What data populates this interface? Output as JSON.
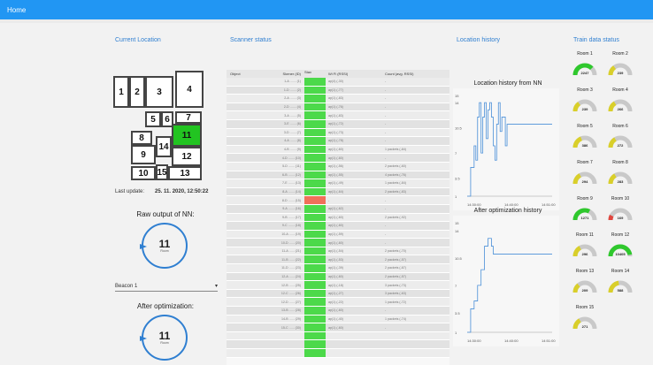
{
  "nav": {
    "home_label": "Home"
  },
  "sections": {
    "current_location": "Current Location",
    "scanner_status": "Scanner status",
    "location_history": "Location history",
    "train_data_status": "Train data status"
  },
  "rooms": [
    {
      "label": "1",
      "active": false
    },
    {
      "label": "2",
      "active": false
    },
    {
      "label": "3",
      "active": false
    },
    {
      "label": "4",
      "active": false
    },
    {
      "label": "5",
      "active": false
    },
    {
      "label": "6",
      "active": false
    },
    {
      "label": "7",
      "active": false
    },
    {
      "label": "8",
      "active": false
    },
    {
      "label": "9",
      "active": false
    },
    {
      "label": "10",
      "active": false
    },
    {
      "label": "11",
      "active": true
    },
    {
      "label": "12",
      "active": false
    },
    {
      "label": "13",
      "active": false
    },
    {
      "label": "14",
      "active": false
    },
    {
      "label": "15",
      "active": false
    }
  ],
  "last_update": {
    "label": "Last update:",
    "value": "25. 11. 2020, 12:50:22"
  },
  "nn_output": {
    "label": "Raw output of NN:",
    "value": "11",
    "unit": "Room"
  },
  "beacon_select": {
    "value": "Beacon 1"
  },
  "after_opt": {
    "label": "After optimization:",
    "value": "11",
    "unit": "Room"
  },
  "scanner_table": {
    "columns": [
      "Object",
      "Skener (ID)",
      "Stav",
      "Wi Fi (RSSI)",
      "Count (avg. RSSI)"
    ],
    "rows": [
      [
        "1-A ....... (1)",
        "green",
        "ap(4) (-30)",
        "-"
      ],
      [
        "1-D ....... (2)",
        "green",
        "ap(1) (-77)",
        "-"
      ],
      [
        "2-A ....... (3)",
        "green",
        "ap(1) (-83)",
        "-"
      ],
      [
        "2-D ....... (4)",
        "green",
        "ap(1) (-76)",
        "-"
      ],
      [
        "3-A ....... (5)",
        "green",
        "ap(1) (-83)",
        "-"
      ],
      [
        "3-E ....... (6)",
        "green",
        "ap(1) (-72)",
        "-"
      ],
      [
        "3-D ....... (7)",
        "green",
        "ap(1) (-73)",
        "-"
      ],
      [
        "4-A ....... (8)",
        "green",
        "ap(1) (-78)",
        "-"
      ],
      [
        "4-B ....... (9)",
        "green",
        "ap(1) (-60)",
        "1 packets (-84)"
      ],
      [
        "4-D ....... (10)",
        "green",
        "ap(1) (-60)",
        "-"
      ],
      [
        "5-D ....... (11)",
        "green",
        "ap(1) (-56)",
        "2 packets (-60)"
      ],
      [
        "6-B ....... (12)",
        "green",
        "ap(1) (-55)",
        "4 packets (-76)"
      ],
      [
        "7-E ....... (13)",
        "green",
        "ap(1) (-49)",
        "1 packets (-84)"
      ],
      [
        "8-A ....... (14)",
        "green",
        "ap(1) (-64)",
        "2 packets (-83)"
      ],
      [
        "8-D ....... (15)",
        "red",
        "-",
        "-"
      ],
      [
        "9-A ....... (16)",
        "green",
        "ap(1) (-62)",
        "-"
      ],
      [
        "9-B ....... (17)",
        "green",
        "ap(1) (-60)",
        "2 packets (-92)"
      ],
      [
        "9-C ....... (18)",
        "green",
        "ap(1) (-60)",
        "-"
      ],
      [
        "10-A ...... (19)",
        "green",
        "ap(1) (-59)",
        "-"
      ],
      [
        "10-D ...... (20)",
        "green",
        "ap(1) (-60)",
        "-"
      ],
      [
        "11-A ...... (21)",
        "green",
        "ap(1) (-54)",
        "2 packets (-70)"
      ],
      [
        "11-B ...... (22)",
        "green",
        "ap(1) (-53)",
        "2 packets (-57)"
      ],
      [
        "11-D ...... (23)",
        "green",
        "ap(1) (-39)",
        "2 packets (-67)"
      ],
      [
        "12-A ...... (24)",
        "green",
        "ap(1) (-60)",
        "2 packets (-57)"
      ],
      [
        "12-B ...... (25)",
        "green",
        "ap(1) (-18)",
        "3 packets (-73)"
      ],
      [
        "12-C ...... (26)",
        "green",
        "ap(1) (-27)",
        "3 packets (-63)"
      ],
      [
        "12-D ...... (27)",
        "green",
        "ap(1) (-22)",
        "1 packets (-72)"
      ],
      [
        "13-B ...... (28)",
        "green",
        "ap(1) (-60)",
        "-"
      ],
      [
        "14-B ...... (29)",
        "green",
        "ap(1) (-40)",
        "1 packets (-74)"
      ],
      [
        "15-C ...... (30)",
        "green",
        "ap(1) (-60)",
        "-"
      ],
      [
        "",
        "green",
        "",
        ""
      ],
      [
        "",
        "green",
        "",
        ""
      ],
      [
        "",
        "green",
        "",
        ""
      ]
    ]
  },
  "status_colors": {
    "green": "#4cd94a",
    "red": "#f0705a"
  },
  "charts": [
    {
      "title": "Location history from NN",
      "y_ticks": [
        "15",
        "14",
        "10.5",
        "7",
        "3.5",
        "1"
      ],
      "x_ticks": [
        "14:30:00",
        "14:40:00",
        "14:51:00"
      ],
      "y_values": [
        1,
        1,
        5,
        5,
        8,
        6,
        12,
        14,
        7,
        12,
        14,
        9,
        13,
        14,
        12,
        8,
        6,
        11,
        14,
        10,
        12,
        12,
        8,
        11,
        11,
        11,
        11,
        11,
        11,
        11,
        11,
        11,
        11,
        11,
        11,
        11,
        11,
        11,
        11,
        11,
        11,
        11,
        11,
        11,
        11,
        11,
        11,
        11,
        11,
        11
      ]
    },
    {
      "title": "After optimization history",
      "y_ticks": [
        "15",
        "14",
        "10.5",
        "7",
        "3.5",
        "1"
      ],
      "x_ticks": [
        "14:30:00",
        "14:40:00",
        "14:51:00"
      ],
      "y_values": [
        1,
        1,
        4,
        4,
        5,
        5,
        7,
        7,
        9,
        9,
        12,
        12,
        13,
        13,
        12,
        11,
        11,
        11,
        11,
        11,
        11,
        11,
        11,
        11,
        11,
        11,
        11,
        11,
        11,
        11,
        11,
        11,
        11,
        11,
        11,
        11,
        11,
        11,
        11,
        11,
        11,
        11,
        11,
        11,
        11,
        11,
        11,
        11,
        11,
        11
      ]
    }
  ],
  "gauges": [
    {
      "room": "Room 1",
      "value": "2247",
      "fill": 0.75,
      "color": "#2fc82d"
    },
    {
      "room": "Room 2",
      "value": "239",
      "fill": 0.3,
      "color": "#d9cf2a"
    },
    {
      "room": "Room 3",
      "value": "239",
      "fill": 0.3,
      "color": "#d9cf2a"
    },
    {
      "room": "Room 4",
      "value": "266",
      "fill": 0.32,
      "color": "#d9cf2a"
    },
    {
      "room": "Room 5",
      "value": "386",
      "fill": 0.38,
      "color": "#d9cf2a"
    },
    {
      "room": "Room 6",
      "value": "272",
      "fill": 0.33,
      "color": "#d9cf2a"
    },
    {
      "room": "Room 7",
      "value": "294",
      "fill": 0.34,
      "color": "#d9cf2a"
    },
    {
      "room": "Room 8",
      "value": "283",
      "fill": 0.33,
      "color": "#d9cf2a"
    },
    {
      "room": "Room 9",
      "value": "1271",
      "fill": 0.65,
      "color": "#2fc82d"
    },
    {
      "room": "Room 10",
      "value": "169",
      "fill": 0.15,
      "color": "#e0463e"
    },
    {
      "room": "Room 11",
      "value": "296",
      "fill": 0.34,
      "color": "#d9cf2a"
    },
    {
      "room": "Room 12",
      "value": "10405",
      "fill": 0.95,
      "color": "#2fc82d"
    },
    {
      "room": "Room 13",
      "value": "209",
      "fill": 0.28,
      "color": "#d9cf2a"
    },
    {
      "room": "Room 14",
      "value": "588",
      "fill": 0.45,
      "color": "#d9cf2a"
    },
    {
      "room": "Room 15",
      "value": "271",
      "fill": 0.33,
      "color": "#d9cf2a"
    }
  ]
}
